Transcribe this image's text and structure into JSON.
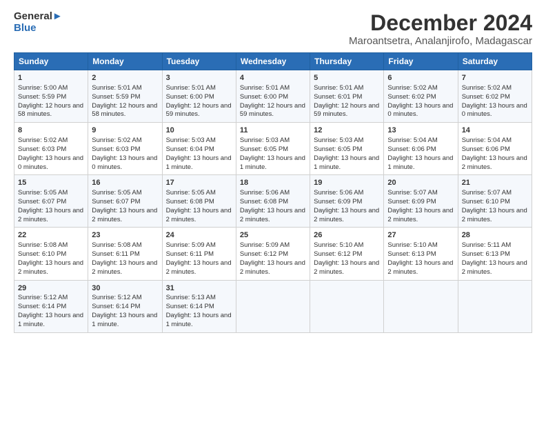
{
  "logo": {
    "text1": "General",
    "text2": "Blue"
  },
  "title": "December 2024",
  "subtitle": "Maroantsetra, Analanjirofo, Madagascar",
  "days_header": [
    "Sunday",
    "Monday",
    "Tuesday",
    "Wednesday",
    "Thursday",
    "Friday",
    "Saturday"
  ],
  "weeks": [
    [
      {
        "day": "1",
        "sunrise": "5:00 AM",
        "sunset": "5:59 PM",
        "daylight": "12 hours and 58 minutes."
      },
      {
        "day": "2",
        "sunrise": "5:01 AM",
        "sunset": "5:59 PM",
        "daylight": "12 hours and 58 minutes."
      },
      {
        "day": "3",
        "sunrise": "5:01 AM",
        "sunset": "6:00 PM",
        "daylight": "12 hours and 59 minutes."
      },
      {
        "day": "4",
        "sunrise": "5:01 AM",
        "sunset": "6:00 PM",
        "daylight": "12 hours and 59 minutes."
      },
      {
        "day": "5",
        "sunrise": "5:01 AM",
        "sunset": "6:01 PM",
        "daylight": "12 hours and 59 minutes."
      },
      {
        "day": "6",
        "sunrise": "5:02 AM",
        "sunset": "6:02 PM",
        "daylight": "13 hours and 0 minutes."
      },
      {
        "day": "7",
        "sunrise": "5:02 AM",
        "sunset": "6:02 PM",
        "daylight": "13 hours and 0 minutes."
      }
    ],
    [
      {
        "day": "8",
        "sunrise": "5:02 AM",
        "sunset": "6:03 PM",
        "daylight": "13 hours and 0 minutes."
      },
      {
        "day": "9",
        "sunrise": "5:02 AM",
        "sunset": "6:03 PM",
        "daylight": "13 hours and 0 minutes."
      },
      {
        "day": "10",
        "sunrise": "5:03 AM",
        "sunset": "6:04 PM",
        "daylight": "13 hours and 1 minute."
      },
      {
        "day": "11",
        "sunrise": "5:03 AM",
        "sunset": "6:05 PM",
        "daylight": "13 hours and 1 minute."
      },
      {
        "day": "12",
        "sunrise": "5:03 AM",
        "sunset": "6:05 PM",
        "daylight": "13 hours and 1 minute."
      },
      {
        "day": "13",
        "sunrise": "5:04 AM",
        "sunset": "6:06 PM",
        "daylight": "13 hours and 1 minute."
      },
      {
        "day": "14",
        "sunrise": "5:04 AM",
        "sunset": "6:06 PM",
        "daylight": "13 hours and 2 minutes."
      }
    ],
    [
      {
        "day": "15",
        "sunrise": "5:05 AM",
        "sunset": "6:07 PM",
        "daylight": "13 hours and 2 minutes."
      },
      {
        "day": "16",
        "sunrise": "5:05 AM",
        "sunset": "6:07 PM",
        "daylight": "13 hours and 2 minutes."
      },
      {
        "day": "17",
        "sunrise": "5:05 AM",
        "sunset": "6:08 PM",
        "daylight": "13 hours and 2 minutes."
      },
      {
        "day": "18",
        "sunrise": "5:06 AM",
        "sunset": "6:08 PM",
        "daylight": "13 hours and 2 minutes."
      },
      {
        "day": "19",
        "sunrise": "5:06 AM",
        "sunset": "6:09 PM",
        "daylight": "13 hours and 2 minutes."
      },
      {
        "day": "20",
        "sunrise": "5:07 AM",
        "sunset": "6:09 PM",
        "daylight": "13 hours and 2 minutes."
      },
      {
        "day": "21",
        "sunrise": "5:07 AM",
        "sunset": "6:10 PM",
        "daylight": "13 hours and 2 minutes."
      }
    ],
    [
      {
        "day": "22",
        "sunrise": "5:08 AM",
        "sunset": "6:10 PM",
        "daylight": "13 hours and 2 minutes."
      },
      {
        "day": "23",
        "sunrise": "5:08 AM",
        "sunset": "6:11 PM",
        "daylight": "13 hours and 2 minutes."
      },
      {
        "day": "24",
        "sunrise": "5:09 AM",
        "sunset": "6:11 PM",
        "daylight": "13 hours and 2 minutes."
      },
      {
        "day": "25",
        "sunrise": "5:09 AM",
        "sunset": "6:12 PM",
        "daylight": "13 hours and 2 minutes."
      },
      {
        "day": "26",
        "sunrise": "5:10 AM",
        "sunset": "6:12 PM",
        "daylight": "13 hours and 2 minutes."
      },
      {
        "day": "27",
        "sunrise": "5:10 AM",
        "sunset": "6:13 PM",
        "daylight": "13 hours and 2 minutes."
      },
      {
        "day": "28",
        "sunrise": "5:11 AM",
        "sunset": "6:13 PM",
        "daylight": "13 hours and 2 minutes."
      }
    ],
    [
      {
        "day": "29",
        "sunrise": "5:12 AM",
        "sunset": "6:14 PM",
        "daylight": "13 hours and 1 minute."
      },
      {
        "day": "30",
        "sunrise": "5:12 AM",
        "sunset": "6:14 PM",
        "daylight": "13 hours and 1 minute."
      },
      {
        "day": "31",
        "sunrise": "5:13 AM",
        "sunset": "6:14 PM",
        "daylight": "13 hours and 1 minute."
      },
      null,
      null,
      null,
      null
    ]
  ]
}
